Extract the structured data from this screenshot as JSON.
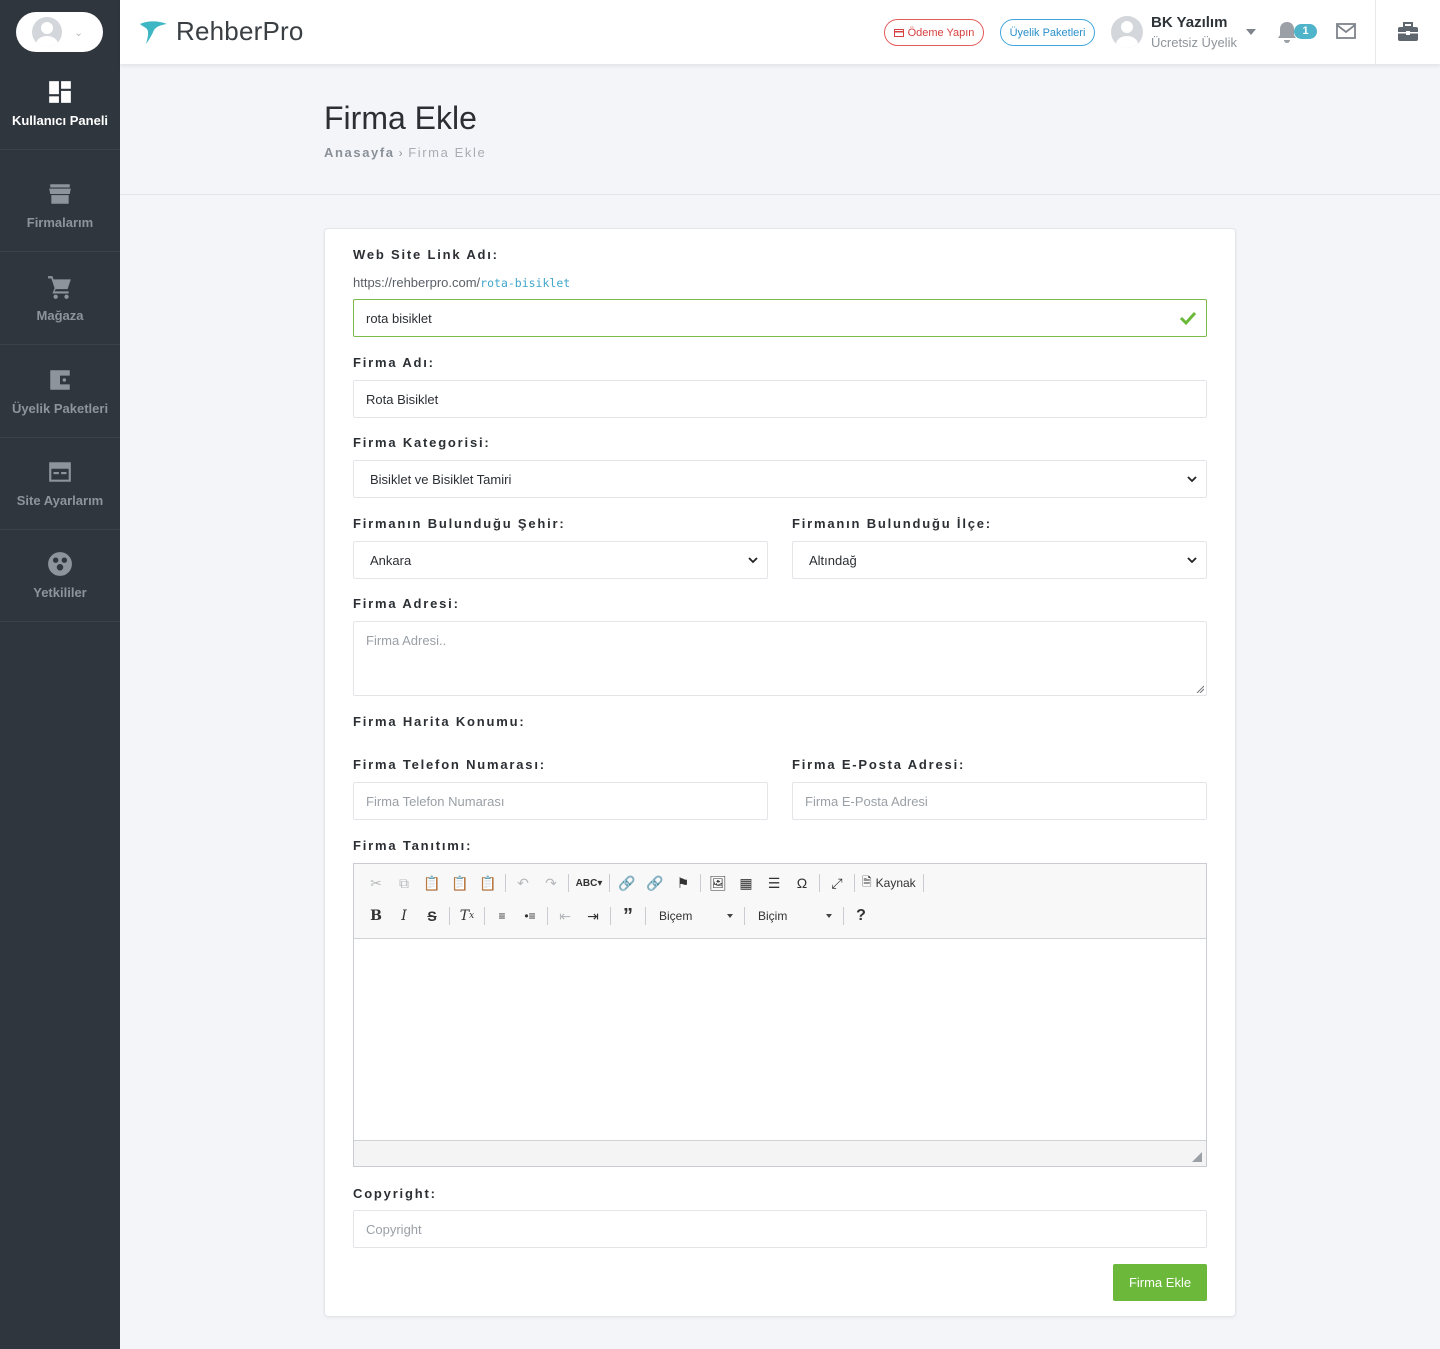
{
  "colors": {
    "sidebar_bg": "#2f363d",
    "accent_green": "#6bb83a",
    "accent_teal": "#4fb3c9",
    "danger": "#d64040",
    "info": "#2a8fc9"
  },
  "sidebar": {
    "items": [
      {
        "label": "Kullanıcı Paneli",
        "icon": "dashboard-icon",
        "active": true
      },
      {
        "label": "Firmalarım",
        "icon": "store-icon",
        "active": false
      },
      {
        "label": "Mağaza",
        "icon": "cart-icon",
        "active": false
      },
      {
        "label": "Üyelik Paketleri",
        "icon": "wallet-icon",
        "active": false
      },
      {
        "label": "Site Ayarlarım",
        "icon": "browser-icon",
        "active": false
      },
      {
        "label": "Yetkililer",
        "icon": "users-icon",
        "active": false
      }
    ]
  },
  "header": {
    "brand": "RehberPro",
    "pay_button": "Ödeme Yapın",
    "packages_button": "Üyelik Paketleri",
    "user_name": "BK Yazılım",
    "user_plan": "Ücretsiz Üyelik",
    "notification_count": "1"
  },
  "page": {
    "title": "Firma Ekle",
    "breadcrumb_home": "Anasayfa",
    "breadcrumb_current": "Firma Ekle"
  },
  "form": {
    "link_label": "Web Site Link Adı:",
    "link_prefix": "https://rehberpro.com/",
    "link_slug": "rota-bisiklet",
    "link_value": "rota bisiklet",
    "name_label": "Firma Adı:",
    "name_value": "Rota Bisiklet",
    "category_label": "Firma Kategorisi:",
    "category_value": "Bisiklet ve Bisiklet Tamiri",
    "city_label": "Firmanın Bulunduğu Şehir:",
    "city_value": "Ankara",
    "district_label": "Firmanın Bulunduğu İlçe:",
    "district_value": "Altındağ",
    "address_label": "Firma Adresi:",
    "address_placeholder": "Firma Adresi..",
    "map_label": "Firma Harita Konumu:",
    "phone_label": "Firma Telefon Numarası:",
    "phone_placeholder": "Firma Telefon Numarası",
    "email_label": "Firma E-Posta Adresi:",
    "email_placeholder": "Firma E-Posta Adresi",
    "intro_label": "Firma Tanıtımı:",
    "copyright_label": "Copyright:",
    "copyright_placeholder": "Copyright",
    "submit": "Firma Ekle"
  },
  "editor": {
    "source_button": "Kaynak",
    "style_combo": "Biçem",
    "format_combo": "Biçim"
  }
}
